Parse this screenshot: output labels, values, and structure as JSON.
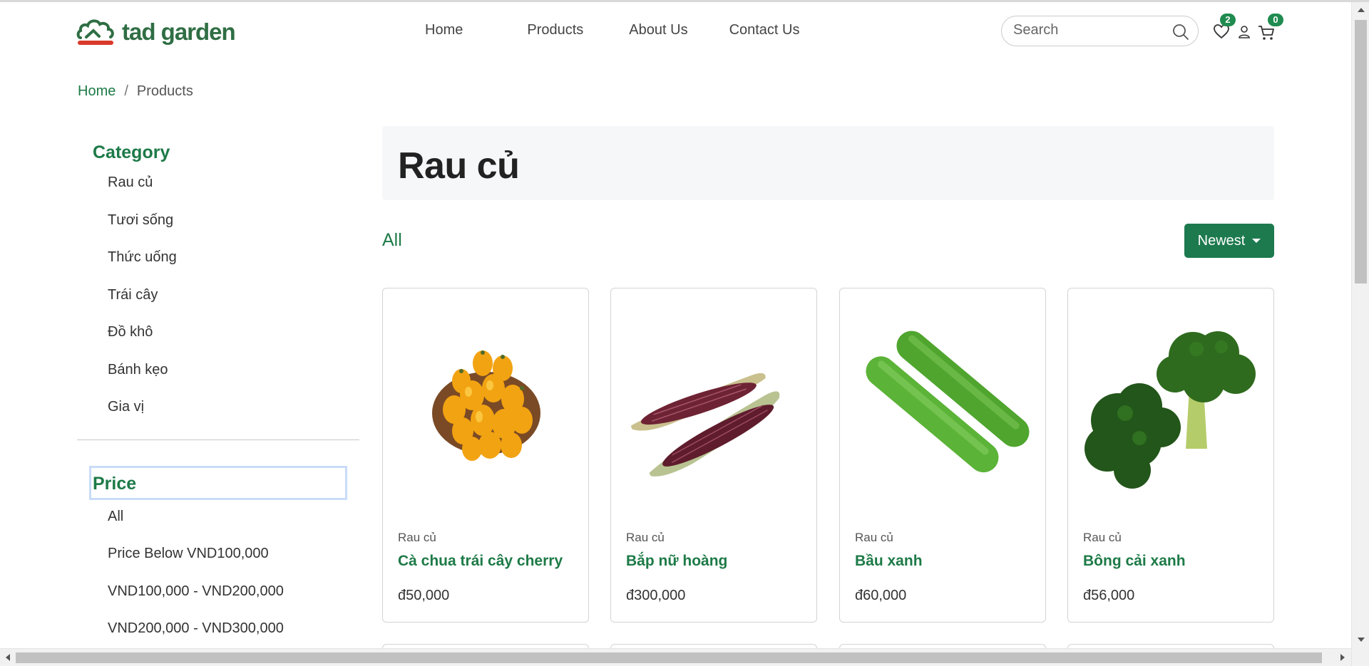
{
  "header": {
    "logo_text": "tad garden",
    "nav": [
      {
        "label": "Home"
      },
      {
        "label": "Products"
      },
      {
        "label": "About Us"
      },
      {
        "label": "Contact Us"
      }
    ],
    "search_placeholder": "Search",
    "wishlist_count": "2",
    "cart_count": "0"
  },
  "breadcrumb": {
    "home": "Home",
    "separator": "/",
    "current": "Products"
  },
  "sidebar": {
    "category_title": "Category",
    "categories": [
      "Rau củ",
      "Tươi sống",
      "Thức uống",
      "Trái cây",
      "Đồ khô",
      "Bánh kẹo",
      "Gia vị"
    ],
    "price_title": "Price",
    "price_options": [
      "All",
      "Price Below VND100,000",
      "VND100,000 - VND200,000",
      "VND200,000 - VND300,000"
    ]
  },
  "main": {
    "page_title": "Rau củ",
    "filter_label": "All",
    "sort_label": "Newest",
    "products": [
      {
        "category": "Rau củ",
        "name": "Cà chua trái cây cherry",
        "price": "đ50,000",
        "image": "cherry-tomato-image"
      },
      {
        "category": "Rau củ",
        "name": "Bắp nữ hoàng",
        "price": "đ300,000",
        "image": "purple-corn-image"
      },
      {
        "category": "Rau củ",
        "name": "Bầu xanh",
        "price": "đ60,000",
        "image": "green-gourd-image"
      },
      {
        "category": "Rau củ",
        "name": "Bông cải xanh",
        "price": "đ56,000",
        "image": "broccoli-image"
      }
    ]
  },
  "colors": {
    "brand_green": "#1d7a47",
    "button_green": "#1d7a4e",
    "badge_green": "#1f8b50",
    "logo_red": "#d93a2b"
  }
}
